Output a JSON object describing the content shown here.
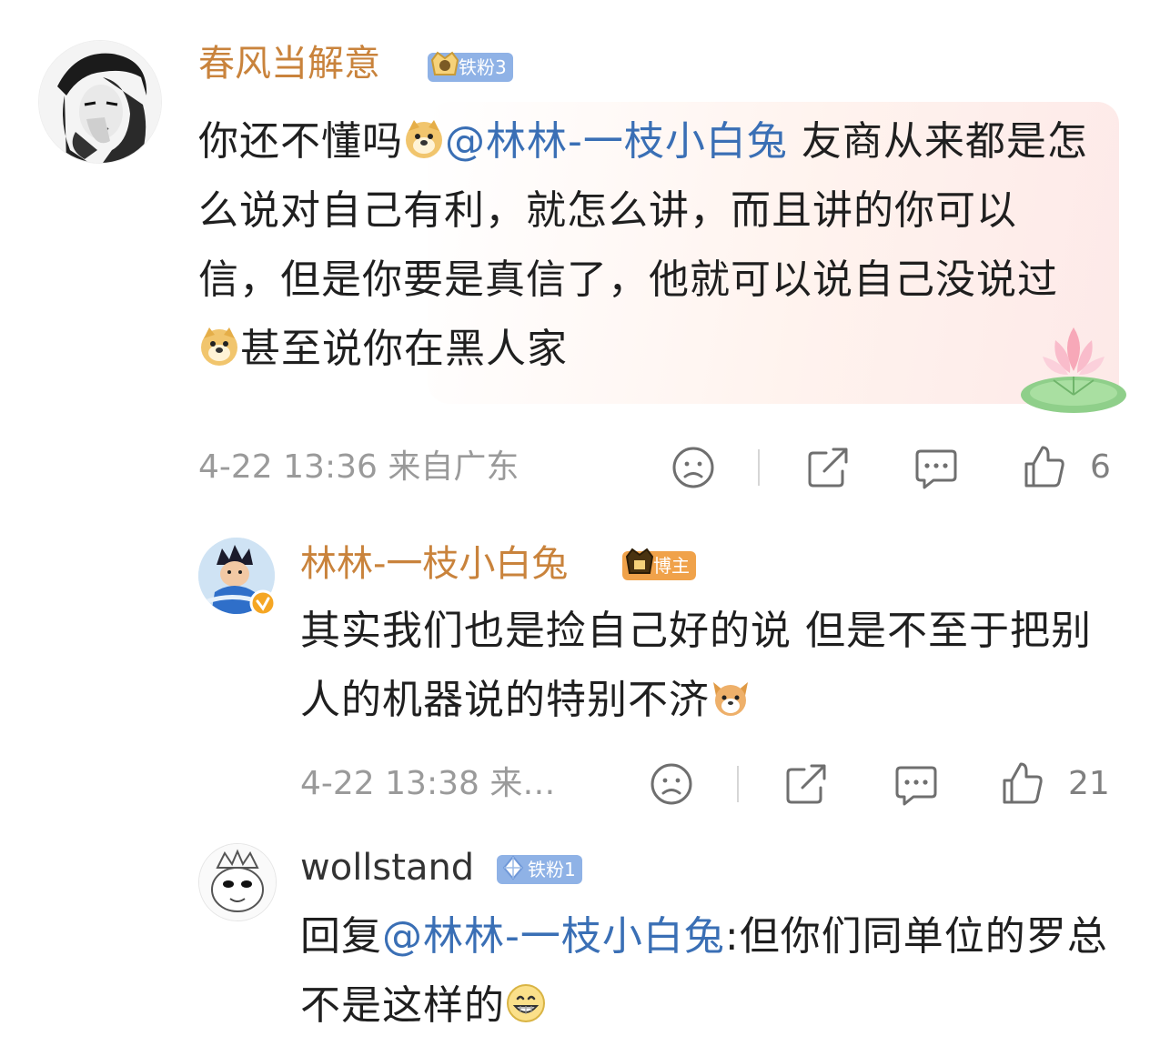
{
  "comment": {
    "username": "春风当解意",
    "badge": "铁粉3",
    "text_parts": {
      "a": "你还不懂吗",
      "mention": "@林林-一枝小白兔",
      "b": " 友商从来都是怎么说对自己有利，就怎么讲，而且讲的你可以信，但是你要是真信了，他就可以说自己没说过",
      "c": "甚至说你在黑人家"
    },
    "meta": "4-22 13:36 来自广东",
    "likes": "6"
  },
  "reply1": {
    "username": "林林-一枝小白兔",
    "badge": "博主",
    "text_parts": {
      "a": "其实我们也是捡自己好的说 但是不至于把别人的机器说的特别不济"
    },
    "meta": "4-22 13:38 来…",
    "likes": "21"
  },
  "reply2": {
    "username": "wollstand",
    "badge": "铁粉1",
    "text_parts": {
      "prefix": "回复",
      "mention": "@林林-一枝小白兔",
      "a": ":但你们同单位的罗总不是这样的"
    }
  },
  "colors": {
    "username_orange": "#c9833c",
    "mention_blue": "#3a6fb5",
    "meta_gray": "#9a9a9a"
  },
  "icons": [
    "face-sad-icon",
    "share-icon",
    "comment-icon",
    "thumbs-up-icon",
    "doge-emoji-icon",
    "lotus-sticker-icon",
    "crown-icon",
    "diamond-icon",
    "verified-icon"
  ]
}
